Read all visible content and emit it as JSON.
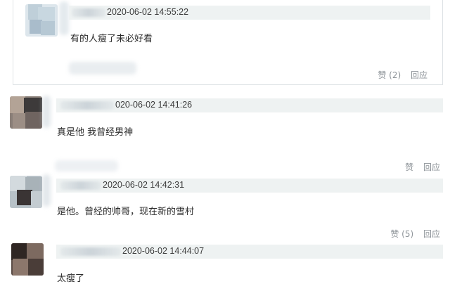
{
  "comments": [
    {
      "time": "2020-06-02 14:55:22",
      "text": "有的人瘦了未必好看",
      "like_label": "赞",
      "like_count": "(2)",
      "reply_label": "回应"
    },
    {
      "time": "020-06-02 14:41:26",
      "text": "真是他 我曾经男神",
      "like_label": "赞",
      "like_count": "",
      "reply_label": "回应"
    },
    {
      "time": "2020-06-02 14:42:31",
      "text": "是他。曾经的帅哥，现在新的雪村",
      "like_label": "赞",
      "like_count": "(5)",
      "reply_label": "回应"
    },
    {
      "time": "2020-06-02 14:44:07",
      "text": "太瘦了"
    }
  ],
  "colors": {
    "meta_bar": "#eef2f2",
    "action_text": "#8d9398",
    "card_border": "#dfe3e6"
  },
  "icons": {
    "avatar": "avatar-icon",
    "like": "like-text-link",
    "reply": "reply-text-link"
  }
}
